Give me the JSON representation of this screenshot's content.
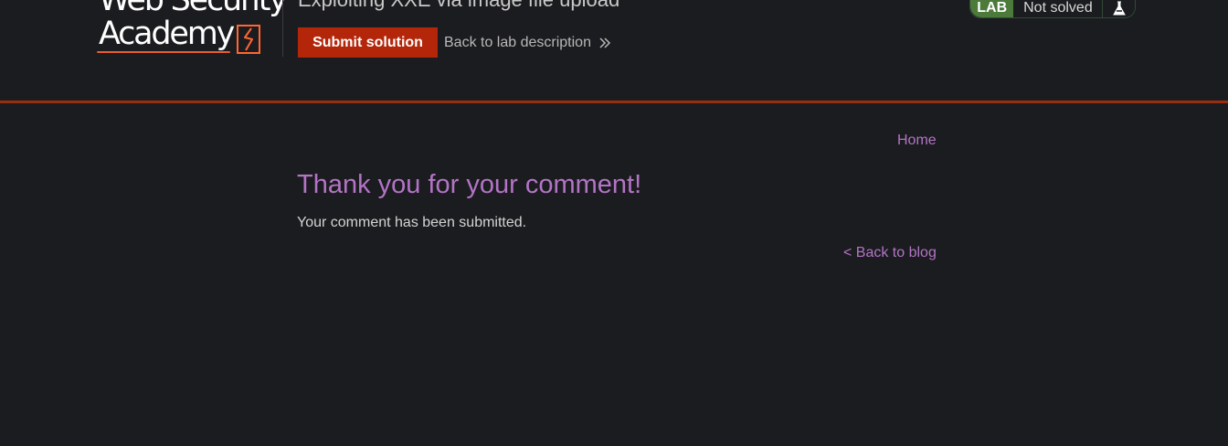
{
  "header": {
    "logo": {
      "line1": "Web Security",
      "line2": "Academy",
      "accent_color": "#ff6633"
    },
    "lab_title": "Exploiting XXE via image file upload",
    "submit_label": "Submit solution",
    "back_to_description_label": "Back to lab description",
    "back_icon": "double-chevron-right-icon",
    "lab_badge": {
      "tag": "LAB",
      "status": "Not solved",
      "icon": "flask-icon",
      "tag_color": "#4c7a3a"
    },
    "accent_border_color": "#9a2c12"
  },
  "nav": {
    "home_label": "Home"
  },
  "main": {
    "heading": "Thank you for your comment!",
    "message": "Your comment has been submitted.",
    "back_to_blog_label": "< Back to blog"
  },
  "colors": {
    "background": "#1b1c1f",
    "link": "#b374c6",
    "button": "#b3260a"
  }
}
